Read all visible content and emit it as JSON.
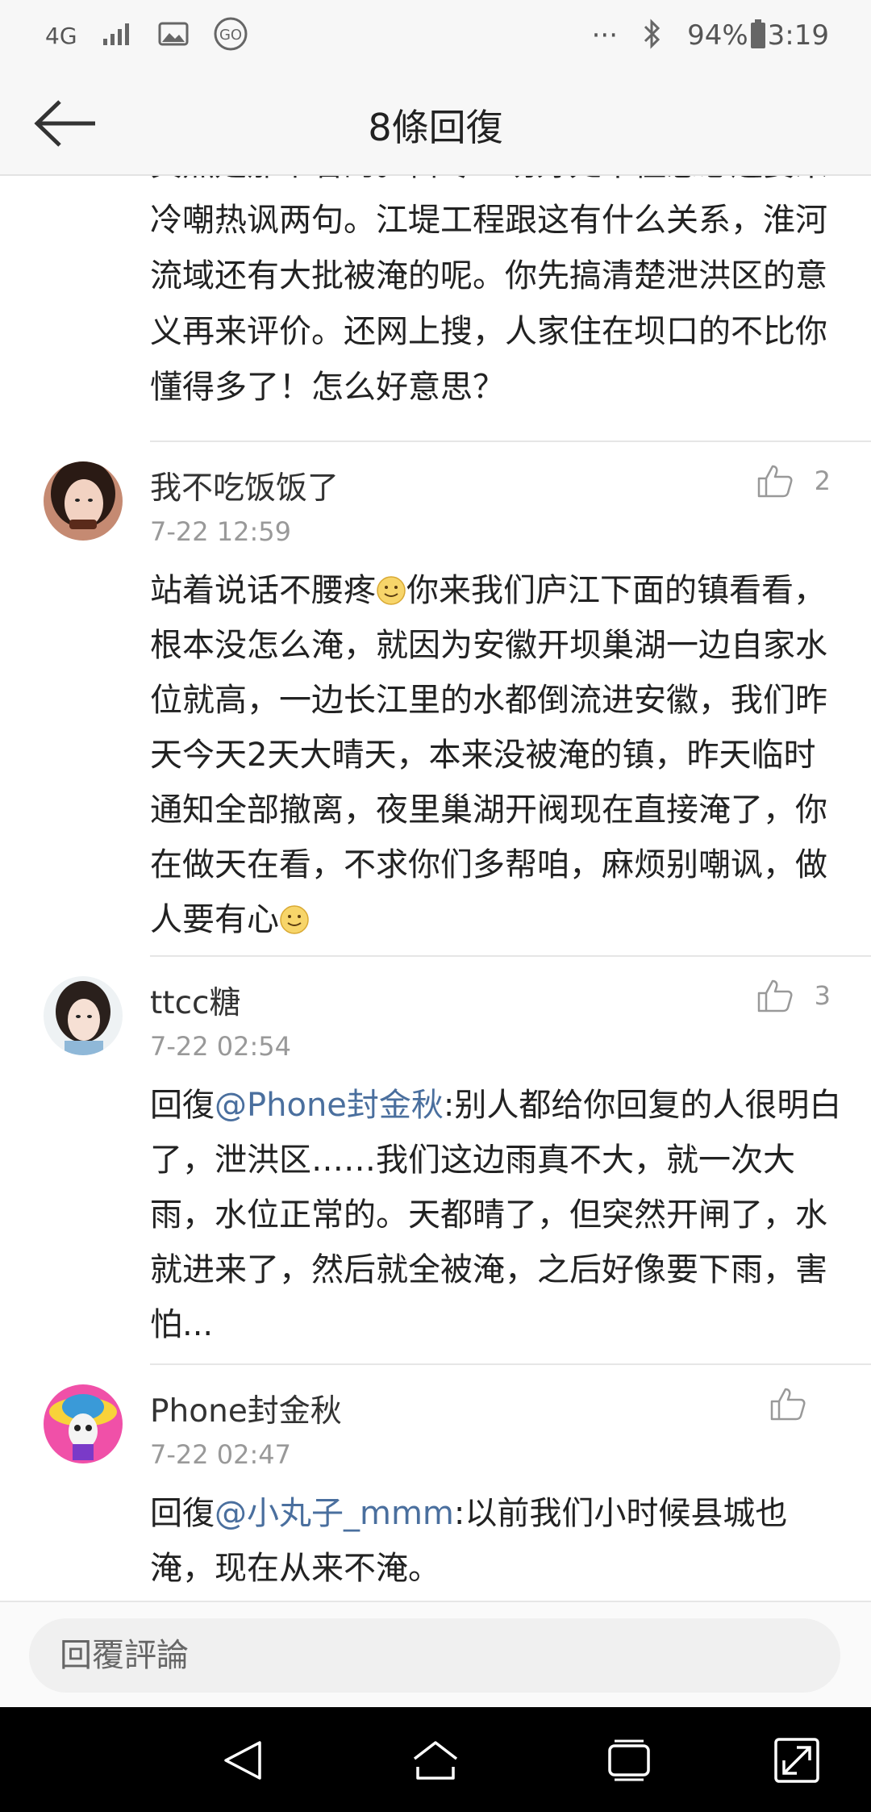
{
  "status_bar": {
    "network": "4G",
    "battery": "94%",
    "time": "3:19",
    "more": "···"
  },
  "header": {
    "title": "8條回復"
  },
  "partial_comment": {
    "text": "真然是那个看的。占尽一切好处不懂感恩还要来冷嘲热讽两句。江堤工程跟这有什么关系，淮河流域还有大批被淹的呢。你先搞清楚泄洪区的意义再来评价。还网上搜，人家住在坝口的不比你懂得多了！怎么好意思？"
  },
  "comments": [
    {
      "username": "我不吃饭饭了",
      "time": "7-22 12:59",
      "likes": "2",
      "text_1": "站着说话不腰疼",
      "text_2": "你来我们庐江下面的镇看看，根本没怎么淹，就因为安徽开坝巢湖一边自家水位就高，一边长江里的水都倒流进安徽，我们昨天今天2天大晴天，本来没被淹的镇，昨天临时通知全部撤离，夜里巢湖开阀现在直接淹了，你在做天在看，不求你们多帮咱，麻烦别嘲讽，做人要有心"
    },
    {
      "username": "ttcc糖",
      "time": "7-22 02:54",
      "likes": "3",
      "reply_prefix": "回復",
      "mention": "@Phone封金秋",
      "text": ":别人都给你回复的人很明白了，泄洪区……我们这边雨真不大，就一次大雨，水位正常的。天都晴了，但突然开闸了，水就进来了，然后就全被淹，之后好像要下雨，害怕..."
    },
    {
      "username": "Phone封金秋",
      "time": "7-22 02:47",
      "likes": "",
      "reply_prefix": "回復",
      "mention": "@小丸子_mmm",
      "text": ":以前我们小时候县城也淹，现在从来不淹。"
    }
  ],
  "reply_bar": {
    "placeholder": "回覆評論"
  },
  "icons": {
    "back": "arrow-left-icon",
    "like": "thumbs-up-icon",
    "emoji": "smiley-icon",
    "nav_back": "triangle-back-icon",
    "nav_home": "home-icon",
    "nav_recents": "recents-icon",
    "nav_expand": "expand-icon"
  },
  "colors": {
    "mention": "#4a6f9e",
    "secondary_text": "#999999",
    "header_bg": "#f7f7f7"
  }
}
